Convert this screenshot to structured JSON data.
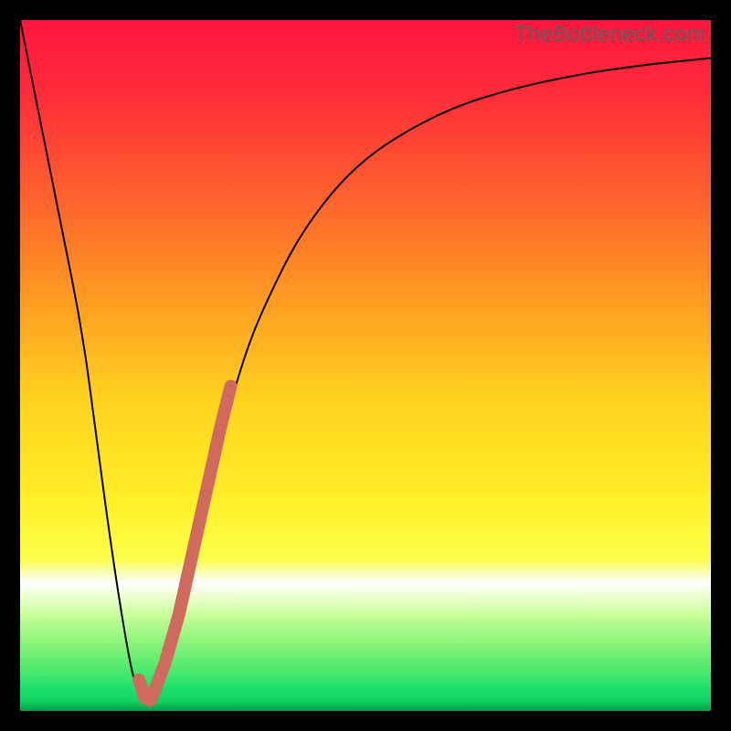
{
  "watermark": "TheBottleneck.com",
  "chart_data": {
    "type": "line",
    "title": "",
    "xlabel": "",
    "ylabel": "",
    "xlim": [
      0,
      100
    ],
    "ylim": [
      0,
      100
    ],
    "grid": false,
    "legend": false,
    "background_gradient": {
      "top_color": "#ff1a3c",
      "mid1_color": "#ff6a2a",
      "mid2_color": "#ffd21a",
      "mid3_color": "#fff43a",
      "bottom_color": "#1fe26b",
      "white_band_at": 0.8
    },
    "series": [
      {
        "name": "bottleneck-curve",
        "type": "line",
        "x": [
          0,
          3,
          6,
          9,
          11,
          13,
          15,
          16.5,
          18,
          20,
          22,
          24,
          26,
          28,
          30,
          33,
          36,
          40,
          45,
          50,
          56,
          63,
          71,
          80,
          90,
          100
        ],
        "y": [
          100,
          85,
          70,
          55,
          40,
          25,
          12,
          4,
          1,
          3,
          9,
          17,
          26,
          35,
          43,
          53,
          60,
          68,
          75,
          80,
          84,
          87.5,
          90,
          92,
          93.5,
          94.5
        ],
        "stroke": "#000000",
        "stroke_width": 2
      },
      {
        "name": "highlight-segment",
        "type": "line",
        "x": [
          18.5,
          19.5,
          21,
          23,
          25,
          27,
          29,
          30.5
        ],
        "y": [
          2,
          3,
          7,
          14,
          23,
          32,
          41,
          47
        ],
        "stroke": "#d16a5e",
        "stroke_width": 14,
        "linecap": "round"
      },
      {
        "name": "highlight-hook",
        "type": "line",
        "x": [
          17.2,
          18,
          18.8,
          19.3
        ],
        "y": [
          4.5,
          2,
          1.5,
          2.5
        ],
        "stroke": "#d16a5e",
        "stroke_width": 14,
        "linecap": "round"
      }
    ]
  }
}
